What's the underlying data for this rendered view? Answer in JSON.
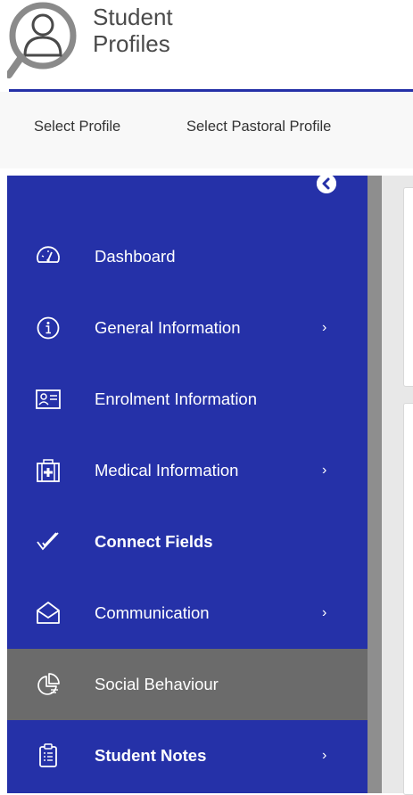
{
  "app": {
    "title_line1": "Student",
    "title_line2": "Profiles"
  },
  "profile_nav": {
    "tabs": [
      {
        "label": "Select Profile"
      },
      {
        "label": "Select Pastoral Profile"
      }
    ]
  },
  "sidebar": {
    "collapse_icon": "chevron-left-circle-icon",
    "items": [
      {
        "label": "Dashboard",
        "icon": "speedometer-icon",
        "has_submenu": false,
        "active": false
      },
      {
        "label": "General Information",
        "icon": "info-circle-icon",
        "has_submenu": true,
        "active": false
      },
      {
        "label": "Enrolment Information",
        "icon": "id-card-icon",
        "has_submenu": false,
        "active": false
      },
      {
        "label": "Medical Information",
        "icon": "medical-kit-icon",
        "has_submenu": true,
        "active": false
      },
      {
        "label": "Connect Fields",
        "icon": "double-check-icon",
        "has_submenu": false,
        "active": false
      },
      {
        "label": "Communication",
        "icon": "envelope-open-icon",
        "has_submenu": true,
        "active": false
      },
      {
        "label": "Social Behaviour",
        "icon": "pie-chart-icon",
        "has_submenu": false,
        "active": true
      },
      {
        "label": "Student Notes",
        "icon": "clipboard-list-icon",
        "has_submenu": true,
        "active": false
      }
    ],
    "chevron": "›"
  },
  "colors": {
    "sidebar_bg": "#2531a8",
    "active_bg": "#6b6b6b",
    "header_rule": "#2531a8",
    "text_light": "#ffffff"
  }
}
